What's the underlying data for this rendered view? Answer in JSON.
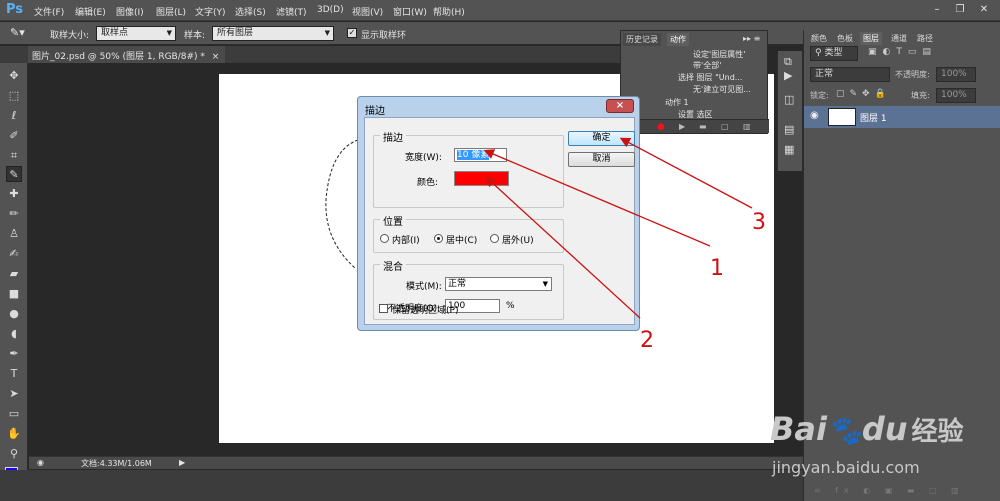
{
  "app": {
    "logo": "Ps"
  },
  "menu": [
    "文件(F)",
    "编辑(E)",
    "图像(I)",
    "图层(L)",
    "文字(Y)",
    "选择(S)",
    "滤镜(T)",
    "3D(D)",
    "视图(V)",
    "窗口(W)",
    "帮助(H)"
  ],
  "window_controls": {
    "minimize": "–",
    "restore": "❐",
    "close": "✕"
  },
  "options_bar": {
    "sample_size_label": "取样大小:",
    "sample_size_value": "取样点",
    "sample_label": "样本:",
    "sample_value": "所有图层",
    "show_ring_label": "显示取样环"
  },
  "document_tab": "图片_02.psd @ 50% (图层 1, RGB/8#) *",
  "status": {
    "zoom": "50%",
    "doc_info": "文档:4.33M/1.06M"
  },
  "history_panel": {
    "tabs": [
      "历史记录",
      "动作"
    ],
    "lines": [
      "设定'图层属性'",
      "带'全部'",
      "选择 图层 \"Und...",
      "无'建立可见图...",
      "动作 1",
      "设置 选区"
    ]
  },
  "layers_panel": {
    "tabs": [
      "颜色",
      "色板",
      "图层",
      "通道",
      "路径"
    ],
    "filter_label": "类型",
    "blend_mode": "正常",
    "opacity_label": "不透明度:",
    "opacity_value": "100%",
    "lock_label": "锁定:",
    "fill_label": "填充:",
    "fill_value": "100%",
    "layer_name": "图层 1"
  },
  "dialog": {
    "title": "描边",
    "stroke_group": "描边",
    "width_label": "宽度(W):",
    "width_value": "10 像素",
    "color_label": "颜色:",
    "color_value": "#ff0000",
    "position_group": "位置",
    "inside_label": "内部(I)",
    "center_label": "居中(C)",
    "outside_label": "居外(U)",
    "blend_group": "混合",
    "mode_label": "模式(M):",
    "mode_value": "正常",
    "opacity_label": "不透明度(O):",
    "opacity_value": "100",
    "percent": "%",
    "preserve_label": "保留透明区域(P)",
    "ok_label": "确定",
    "cancel_label": "取消"
  },
  "annotations": [
    "1",
    "2",
    "3"
  ],
  "watermark": {
    "brand": "Bai",
    "brand_mid": "du",
    "brand_cn": "经验",
    "url": "jingyan.baidu.com"
  },
  "colors": {
    "foreground": "#1a00ff",
    "background": "#ffffff",
    "annotation": "#cc1111"
  }
}
